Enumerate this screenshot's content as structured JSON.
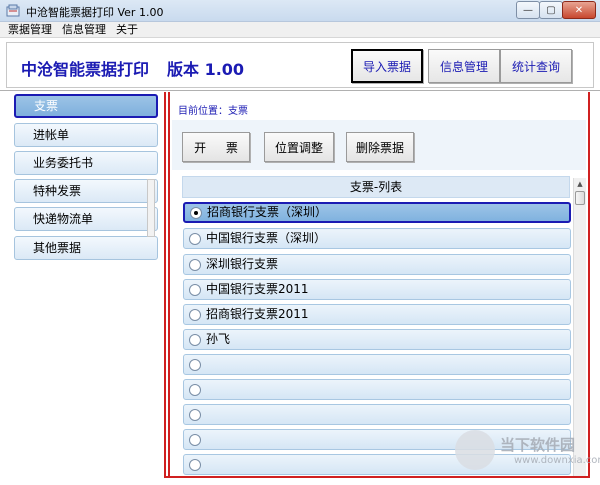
{
  "window": {
    "title": "中沧智能票据打印 Ver 1.00",
    "controls": {
      "minimize": "—",
      "maximize": "▢",
      "close": "✕"
    }
  },
  "menu": [
    "票据管理",
    "信息管理",
    "关于"
  ],
  "header": {
    "title": "中沧智能票据打印",
    "version": "版本 1.00",
    "buttons": {
      "import": "导入票据",
      "info": "信息管理",
      "stats": "统计查询"
    }
  },
  "sidebar": {
    "items": [
      {
        "label": "支票",
        "selected": true
      },
      {
        "label": "进帐单",
        "selected": false
      },
      {
        "label": "业务委托书",
        "selected": false
      },
      {
        "label": "特种发票",
        "selected": false
      },
      {
        "label": "快递物流单",
        "selected": false
      },
      {
        "label": "其他票据",
        "selected": false
      }
    ]
  },
  "breadcrumb": {
    "prefix": "目前位置：",
    "current": "支票"
  },
  "actions": {
    "issue": "开 票",
    "position": "位置调整",
    "delete": "删除票据"
  },
  "list": {
    "header": "支票-列表",
    "items": [
      {
        "label": "招商银行支票（深圳）",
        "selected": true
      },
      {
        "label": "中国银行支票（深圳）",
        "selected": false
      },
      {
        "label": "深圳银行支票",
        "selected": false
      },
      {
        "label": "中国银行支票2011",
        "selected": false
      },
      {
        "label": "招商银行支票2011",
        "selected": false
      },
      {
        "label": "孙飞",
        "selected": false
      },
      {
        "label": "",
        "selected": false
      },
      {
        "label": "",
        "selected": false
      },
      {
        "label": "",
        "selected": false
      },
      {
        "label": "",
        "selected": false
      },
      {
        "label": "",
        "selected": false
      }
    ]
  },
  "watermark": {
    "text": "当下软件园",
    "url": "www.downxia.com"
  },
  "colors": {
    "accent": "#1b1bb3",
    "divider": "#d02020",
    "selection": "#8fbbe3"
  }
}
